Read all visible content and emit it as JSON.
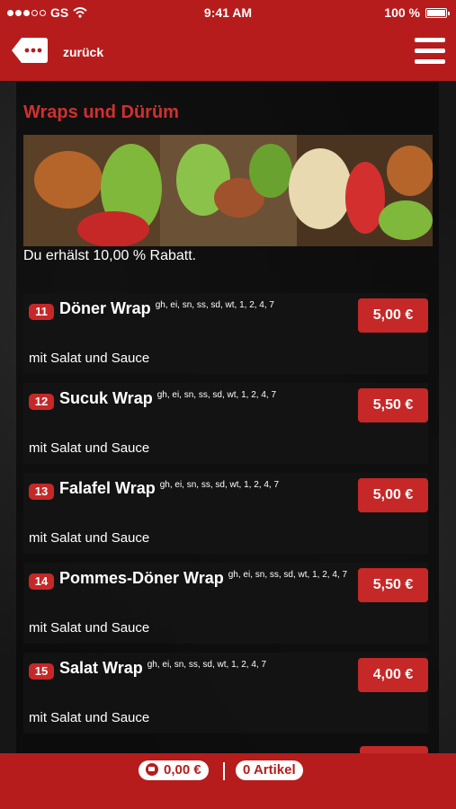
{
  "statusbar": {
    "carrier": "GS",
    "time": "9:41 AM",
    "battery": "100 %"
  },
  "navbar": {
    "back_label": "zurück"
  },
  "section": {
    "title": "Wraps und Dürüm",
    "discount": "Du erhälst 10,00 % Rabatt."
  },
  "items": [
    {
      "num": "11",
      "name": "Döner Wrap",
      "allergens": "gh, ei, sn, ss, sd, wt, 1, 2, 4, 7",
      "desc": "mit Salat und Sauce",
      "price": "5,00 €"
    },
    {
      "num": "12",
      "name": "Sucuk Wrap",
      "allergens": "gh, ei, sn, ss, sd, wt, 1, 2, 4, 7",
      "desc": "mit Salat und Sauce",
      "price": "5,50 €"
    },
    {
      "num": "13",
      "name": "Falafel Wrap",
      "allergens": "gh, ei, sn, ss, sd, wt, 1, 2, 4, 7",
      "desc": "mit Salat und Sauce",
      "price": "5,00 €"
    },
    {
      "num": "14",
      "name": "Pommes-Döner Wrap",
      "allergens": "gh, ei, sn, ss, sd, wt, 1, 2, 4, 7",
      "desc": "mit Salat und Sauce",
      "price": "5,50 €"
    },
    {
      "num": "15",
      "name": "Salat Wrap",
      "allergens": "gh, ei, sn, ss, sd, wt, 1, 2, 4, 7",
      "desc": "mit Salat und Sauce",
      "price": "4,00 €"
    }
  ],
  "footer": {
    "cart_total": "0,00 €",
    "article_count": "0 Artikel"
  },
  "colors": {
    "brand_red": "#b71c1c",
    "accent_red": "#c62828"
  },
  "icons": [
    "signal-dots-icon",
    "wifi-icon",
    "battery-icon",
    "back-tag-icon",
    "hamburger-menu-icon",
    "cart-icon"
  ]
}
